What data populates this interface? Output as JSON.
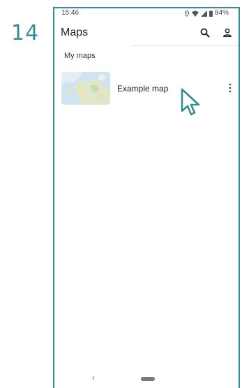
{
  "step": {
    "number": "14"
  },
  "status_bar": {
    "time": "15:46",
    "battery": "84%"
  },
  "app_bar": {
    "title": "Maps"
  },
  "section": {
    "label": "My maps"
  },
  "maps": [
    {
      "name": "Example map"
    }
  ],
  "nav_bar": {
    "back_glyph": "‹"
  },
  "icons": {
    "search": "search-icon",
    "account": "account-icon",
    "overflow": "more-vert-icon",
    "cursor": "pointer-cursor-icon",
    "location": "location-icon",
    "wifi": "wifi-icon",
    "signal": "signal-icon",
    "battery": "battery-icon"
  },
  "colors": {
    "accent": "#3b8a8f",
    "text": "#222222",
    "muted": "#777777"
  }
}
